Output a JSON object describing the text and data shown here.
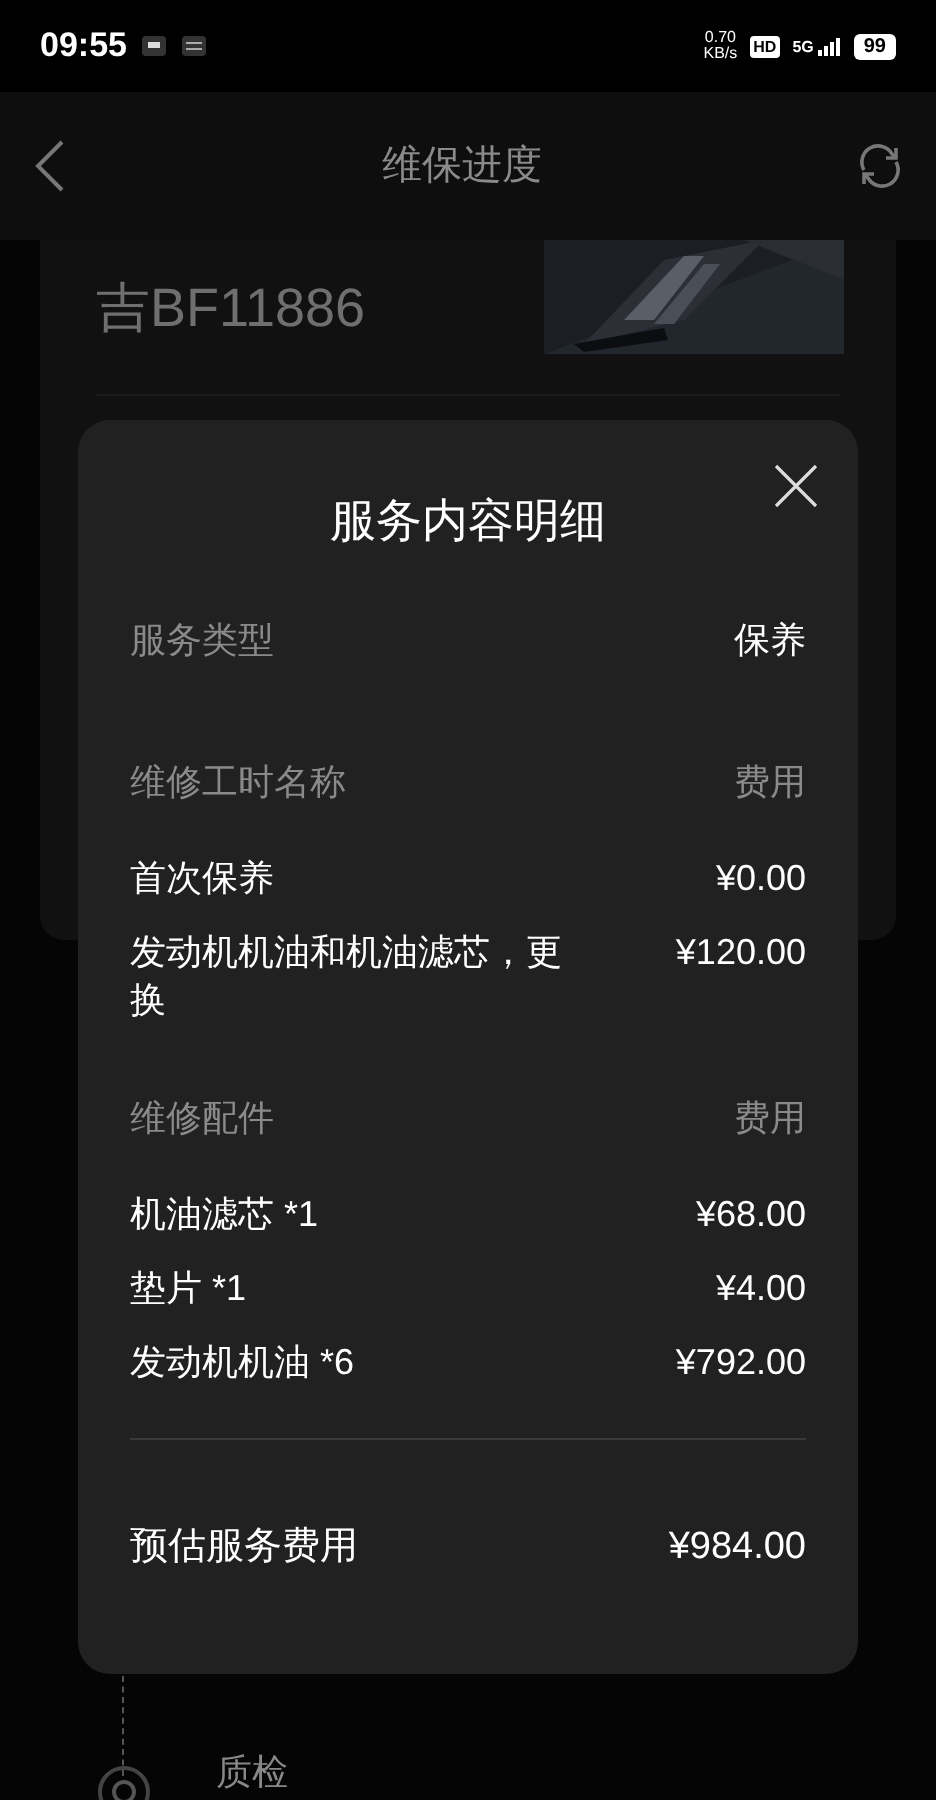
{
  "status_bar": {
    "time": "09:55",
    "net_speed": "0.70",
    "net_unit": "KB/s",
    "hd": "HD",
    "network": "5G",
    "battery": "99"
  },
  "header": {
    "title": "维保进度"
  },
  "vehicle": {
    "plate": "吉BF11886"
  },
  "dialog": {
    "title": "服务内容明细",
    "service_type": {
      "label": "服务类型",
      "value": "保养"
    },
    "sections": [
      {
        "heading": "维修工时名称",
        "heading_value": "费用",
        "items": [
          {
            "name": "首次保养",
            "price": "¥0.00"
          },
          {
            "name": "发动机机油和机油滤芯，更换",
            "price": "¥120.00"
          }
        ]
      },
      {
        "heading": "维修配件",
        "heading_value": "费用",
        "items": [
          {
            "name": "机油滤芯 *1",
            "price": "¥68.00"
          },
          {
            "name": "垫片 *1",
            "price": "¥4.00"
          },
          {
            "name": "发动机机油 *6",
            "price": "¥792.00"
          }
        ]
      }
    ],
    "total": {
      "label": "预估服务费用",
      "value": "¥984.00"
    }
  },
  "timeline": {
    "step": "质检"
  }
}
